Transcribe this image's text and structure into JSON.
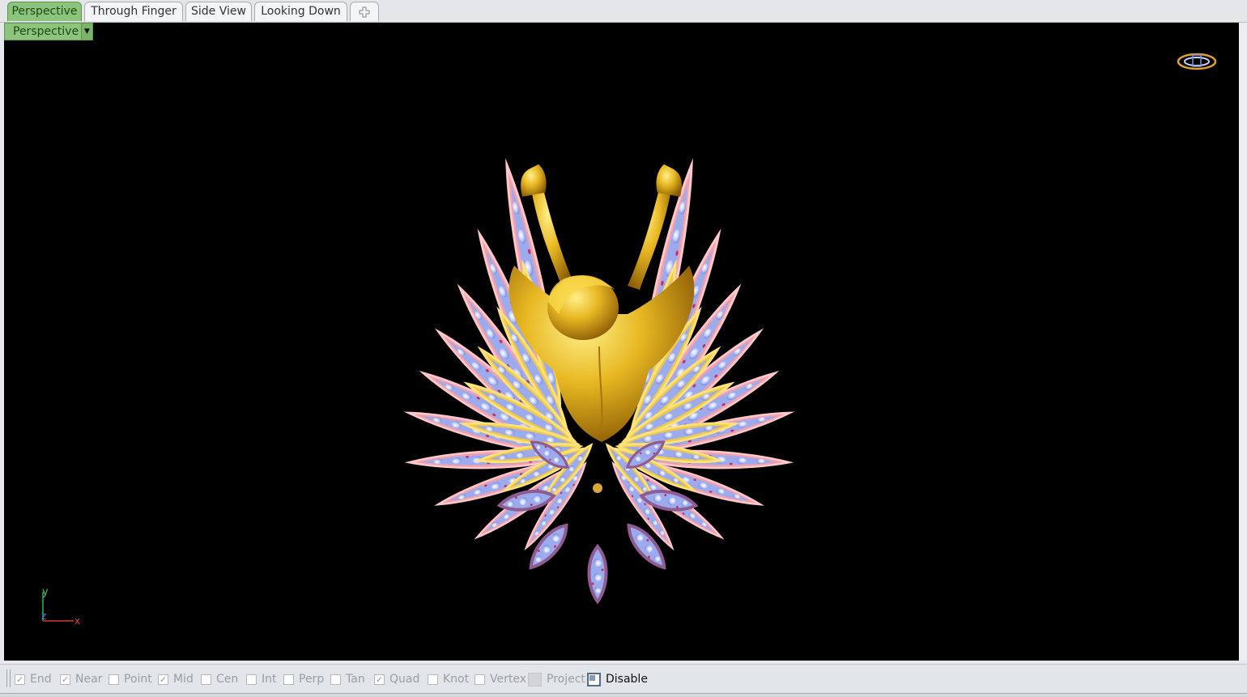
{
  "tabs": [
    {
      "label": "Perspective",
      "active": true
    },
    {
      "label": "Through Finger",
      "active": false
    },
    {
      "label": "Side View",
      "active": false
    },
    {
      "label": "Looking Down",
      "active": false
    }
  ],
  "add_tab_icon": "plus-icon",
  "viewport": {
    "label": "Perspective",
    "dropdown_icon": "triangle-down-icon",
    "background": "#000000",
    "axis": {
      "y": "y",
      "z": "z",
      "x": "x"
    }
  },
  "colors": {
    "accent_tab": "#8cc47b",
    "gold": "#d9a920",
    "pink_outline": "#f2949a",
    "gem_blue": "#aab7f2",
    "purple_outline": "#9a6b95"
  },
  "osnaps": [
    {
      "label": "End",
      "checked": true
    },
    {
      "label": "Near",
      "checked": true
    },
    {
      "label": "Point",
      "checked": false
    },
    {
      "label": "Mid",
      "checked": true
    },
    {
      "label": "Cen",
      "checked": false
    },
    {
      "label": "Int",
      "checked": false
    },
    {
      "label": "Perp",
      "checked": false
    },
    {
      "label": "Tan",
      "checked": false
    },
    {
      "label": "Quad",
      "checked": true
    },
    {
      "label": "Knot",
      "checked": false
    },
    {
      "label": "Vertex",
      "checked": false
    },
    {
      "label": "Project",
      "checked": false
    },
    {
      "label": "Disable",
      "checked": true
    }
  ]
}
